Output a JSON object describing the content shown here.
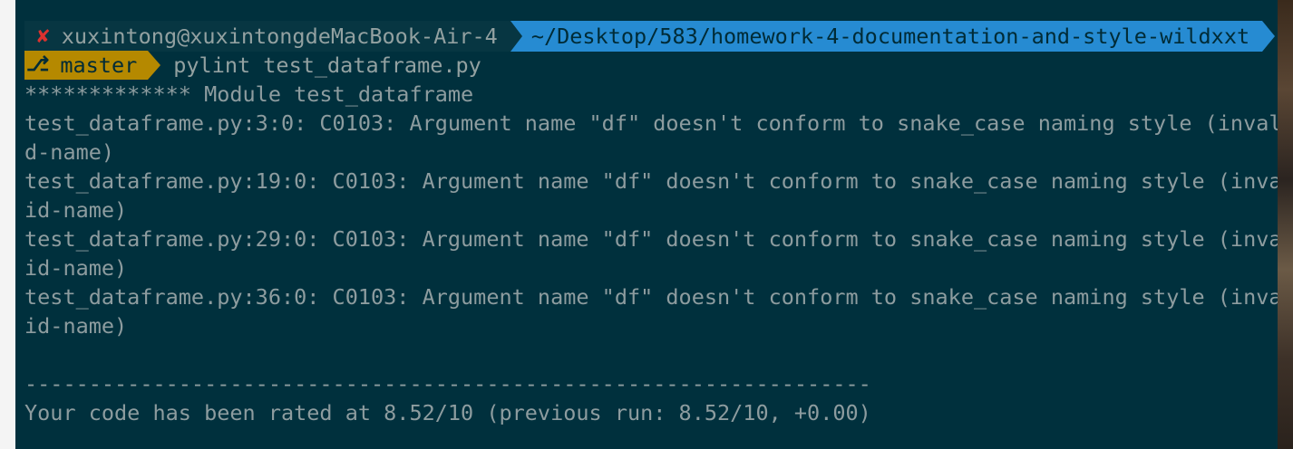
{
  "prompt": {
    "status_icon": "✘",
    "user_host": "xuxintong@xuxintongdeMacBook-Air-4",
    "path": "~/Desktop/583/homework-4-documentation-and-style-wildxxt",
    "branch_icon": "⎇",
    "branch": "master",
    "command": "pylint test_dataframe.py"
  },
  "output": {
    "lines": [
      "************* Module test_dataframe",
      "test_dataframe.py:3:0: C0103: Argument name \"df\" doesn't conform to snake_case naming style (invali",
      "d-name)",
      "test_dataframe.py:19:0: C0103: Argument name \"df\" doesn't conform to snake_case naming style (inval",
      "id-name)",
      "test_dataframe.py:29:0: C0103: Argument name \"df\" doesn't conform to snake_case naming style (inval",
      "id-name)",
      "test_dataframe.py:36:0: C0103: Argument name \"df\" doesn't conform to snake_case naming style (inval",
      "id-name)",
      "",
      "------------------------------------------------------------------",
      "Your code has been rated at 8.52/10 (previous run: 8.52/10, +0.00)"
    ]
  },
  "colors": {
    "background": "#00303d",
    "path_segment": "#268bd2",
    "branch_segment": "#b58900",
    "error_icon": "#dc322f",
    "text": "#8d9c9f"
  }
}
